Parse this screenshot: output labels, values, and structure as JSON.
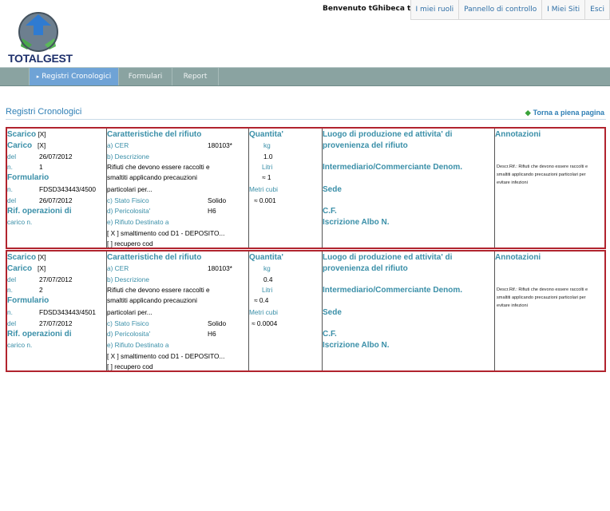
{
  "app": {
    "logo_text": "TOTALGEST",
    "welcome": "Benvenuto tGhibeca tGhibeca!",
    "topnav": [
      "I miei ruoli",
      "Pannello di controllo",
      "I Miei Siti",
      "Esci"
    ],
    "menu": [
      "Registri Cronologici",
      "Formulari",
      "Report"
    ],
    "page_title": "Registri Cronologici",
    "back_link": "Torna a piena pagina"
  },
  "labels": {
    "scarico": "Scarico",
    "carico": "Carico",
    "del": "del",
    "n": "n.",
    "formulario": "Formulario",
    "rif_operazioni": "Rif. operazioni di",
    "carico_n": "carico n.",
    "caratteristiche": "Caratteristiche del rifiuto",
    "cer": "a) CER",
    "descrizione": "b) Descrizione",
    "stato_fisico": "c) Stato Fisico",
    "pericolosita": "d) Pericolosita'",
    "destinato": "e) Rifiuto Destinato a",
    "quantita": "Quantita'",
    "kg": "kg",
    "litri": "Litri",
    "metri_cubi": "Metri cubi",
    "luogo_1": "Luogo di produzione ed attivita' di",
    "luogo_2": "provenienza del rifiuto",
    "intermediario": "Intermediario/Commerciante Denom.",
    "sede": "Sede",
    "cf": "C.F.",
    "iscrizione": "Iscrizione Albo N.",
    "annotazioni": "Annotazioni"
  },
  "records": [
    {
      "scarico": "[X]",
      "carico": "[X]",
      "del": "26/07/2012",
      "n": "1",
      "formulario_n": "FDSD343443/4500",
      "formulario_del": "26/07/2012",
      "cer": "180103*",
      "desc_1": "Rifiuti che devono essere raccolti e",
      "desc_2": "smaltiti applicando precauzioni",
      "desc_3": "particolari per...",
      "stato_fisico": "Solido",
      "pericolosita": "H6",
      "smaltimento": "[ X ] smaltimento cod D1 - DEPOSITO...",
      "recupero": "[ ] recupero cod",
      "kg": "1.0",
      "litri": "≈ 1",
      "metri_cubi": "≈ 0.001",
      "note": "Descr.Rif.: Rifiuti che devono essere raccolti e smaltiti applicando precauzioni particolari per evitare infezioni"
    },
    {
      "scarico": "[X]",
      "carico": "[X]",
      "del": "27/07/2012",
      "n": "2",
      "formulario_n": "FDSD343443/4501",
      "formulario_del": "27/07/2012",
      "cer": "180103*",
      "desc_1": "Rifiuti che devono essere raccolti e",
      "desc_2": "smaltiti applicando precauzioni",
      "desc_3": "particolari per...",
      "stato_fisico": "Solido",
      "pericolosita": "H6",
      "smaltimento": "[ X ] smaltimento cod D1 - DEPOSITO...",
      "recupero": "[ ] recupero cod",
      "kg": "0.4",
      "litri": "≈ 0.4",
      "metri_cubi": "≈ 0.0004",
      "note": "Descr.Rif.: Rifiuti che devono essere raccolti e smaltiti applicando precauzioni particolari per evitare infezioni"
    }
  ]
}
